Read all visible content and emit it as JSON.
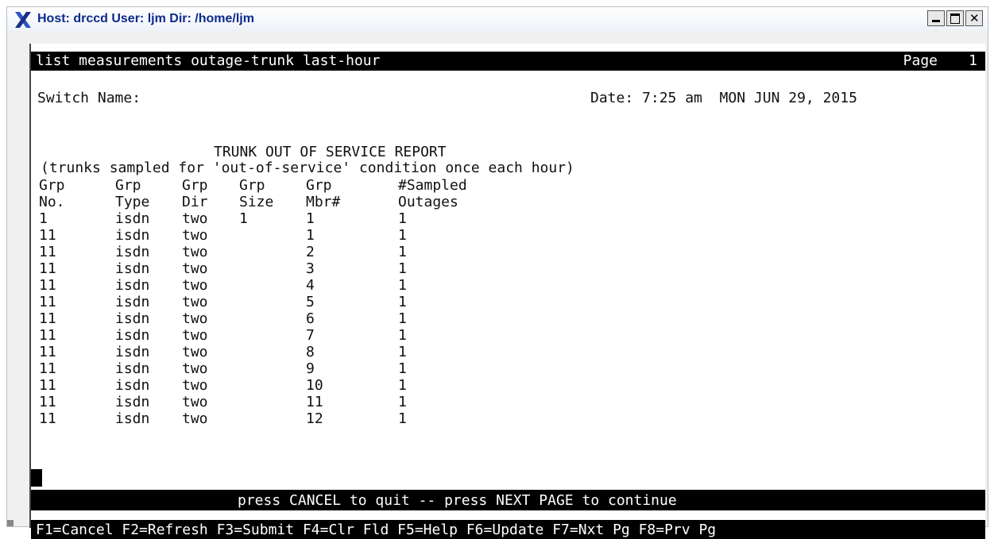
{
  "window": {
    "title": "Host: drccd  User: ljm   Dir: /home/ljm"
  },
  "command_bar": {
    "command": "list measurements outage-trunk last-hour",
    "page_label": "Page",
    "page_number": "1"
  },
  "header": {
    "switch_name": "Switch Name:",
    "date": "Date: 7:25 am  MON JUN 29, 2015"
  },
  "report": {
    "title": "TRUNK OUT OF SERVICE REPORT",
    "subtitle": "(trunks sampled for 'out-of-service' condition once each hour)"
  },
  "table": {
    "header_row1": [
      "Grp",
      "Grp",
      "Grp",
      "Grp",
      "Grp",
      "#Sampled"
    ],
    "header_row2": [
      "No.",
      "Type",
      "Dir",
      "Size",
      "Mbr#",
      "Outages"
    ],
    "rows": [
      [
        "1",
        "isdn",
        "two",
        "1",
        "1",
        "1"
      ],
      [
        "11",
        "isdn",
        "two",
        "",
        "1",
        "1"
      ],
      [
        "11",
        "isdn",
        "two",
        "",
        "2",
        "1"
      ],
      [
        "11",
        "isdn",
        "two",
        "",
        "3",
        "1"
      ],
      [
        "11",
        "isdn",
        "two",
        "",
        "4",
        "1"
      ],
      [
        "11",
        "isdn",
        "two",
        "",
        "5",
        "1"
      ],
      [
        "11",
        "isdn",
        "two",
        "",
        "6",
        "1"
      ],
      [
        "11",
        "isdn",
        "two",
        "",
        "7",
        "1"
      ],
      [
        "11",
        "isdn",
        "two",
        "",
        "8",
        "1"
      ],
      [
        "11",
        "isdn",
        "two",
        "",
        "9",
        "1"
      ],
      [
        "11",
        "isdn",
        "two",
        "",
        "10",
        "1"
      ],
      [
        "11",
        "isdn",
        "two",
        "",
        "11",
        "1"
      ],
      [
        "11",
        "isdn",
        "two",
        "",
        "12",
        "1"
      ]
    ]
  },
  "status": {
    "message": "press CANCEL to quit --  press NEXT PAGE to continue"
  },
  "function_keys": "F1=Cancel F2=Refresh F3=Submit F4=Clr Fld F5=Help F6=Update F7=Nxt Pg F8=Prv Pg"
}
